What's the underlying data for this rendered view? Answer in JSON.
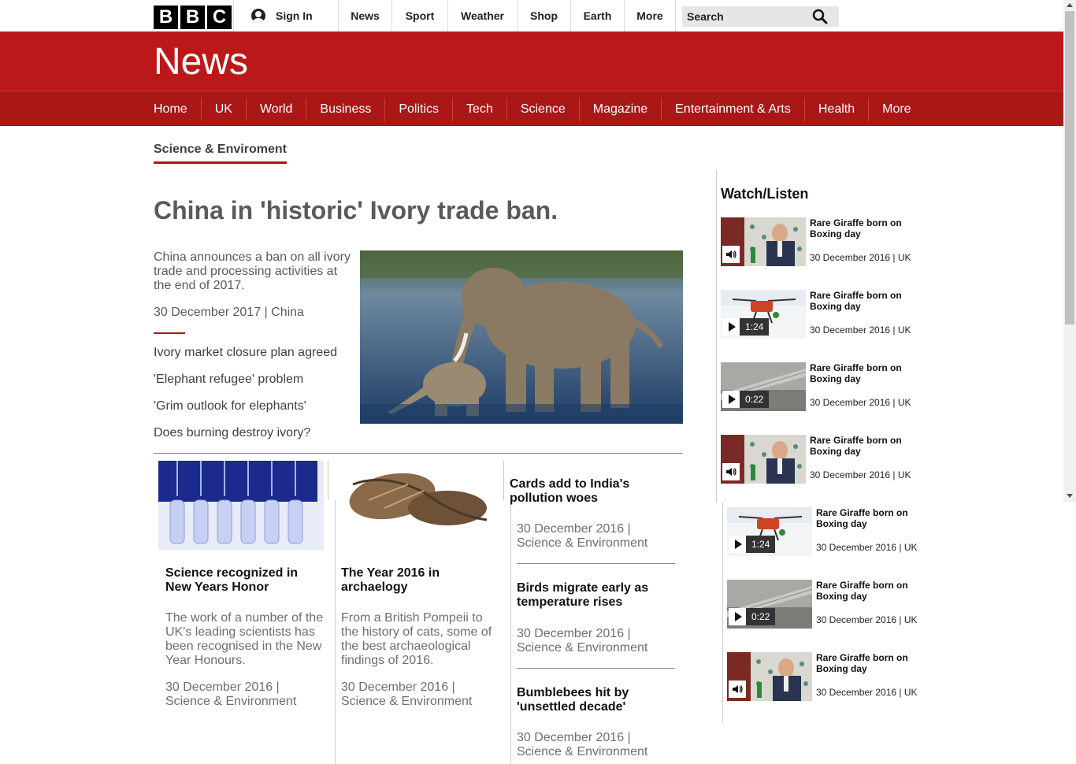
{
  "topbar": {
    "logo_letters": [
      "B",
      "B",
      "C"
    ],
    "signin_label": "Sign In",
    "nav": [
      "News",
      "Sport",
      "Weather",
      "Shop",
      "Earth",
      "More"
    ],
    "search_placeholder": "Search"
  },
  "news": {
    "title": "News",
    "subnav": [
      "Home",
      "UK",
      "World",
      "Business",
      "Politics",
      "Tech",
      "Science",
      "Magazine",
      "Entertainment & Arts",
      "Health",
      "More"
    ]
  },
  "section": {
    "label": "Science & Enviroment"
  },
  "lead": {
    "headline": "China in 'historic' Ivory trade ban.",
    "summary": "China announces a ban on all ivory trade and processing activities at the end of 2017.",
    "date": "30 December 2017 | China",
    "related": [
      "Ivory market closure plan agreed",
      "'Elephant refugee' problem",
      "'Grim outlook for elephants'",
      "Does burning destroy ivory?"
    ]
  },
  "cards": [
    {
      "title": "Science recognized in New Years Honor",
      "summary": "The work of a number of the UK's leading scientists has been recognised in the New Year Honours.",
      "date": "30 December 2016 | Science & Environment"
    },
    {
      "title": "The Year 2016 in archaelogy",
      "summary": "From a British Pompeii to the history of cats, some of the best archaeological findings of 2016.",
      "date": "30 December 2016 | Science & Environment"
    }
  ],
  "list_stories": [
    {
      "title": "Cards add to India's pollution woes",
      "date": "30 December 2016 | Science & Environment"
    },
    {
      "title": "Birds migrate early as temperature rises",
      "date": "30 December 2016 | Science & Environment"
    },
    {
      "title": "Bumblebees hit by 'unsettled decade'",
      "date": "30 December 2016 | Science & Environment"
    }
  ],
  "watch_listen": {
    "title": "Watch/Listen",
    "items": [
      {
        "title": "Rare Giraffe born on Boxing day",
        "date": "30 December 2016 | UK",
        "type": "audio",
        "thumb": "interview"
      },
      {
        "title": "Rare Giraffe born on Boxing day",
        "date": "30 December 2016 | UK",
        "type": "video",
        "duration": "1:24",
        "thumb": "drone"
      },
      {
        "title": "Rare Giraffe born on Boxing day",
        "date": "30 December 2016 | UK",
        "type": "video",
        "duration": "0:22",
        "thumb": "wing"
      },
      {
        "title": "Rare Giraffe born on Boxing day",
        "date": "30 December 2016 | UK",
        "type": "audio",
        "thumb": "interview"
      },
      {
        "title": "Rare Giraffe born on Boxing day",
        "date": "30 December 2016 | UK",
        "type": "video",
        "duration": "1:24",
        "thumb": "drone"
      },
      {
        "title": "Rare Giraffe born on Boxing day",
        "date": "30 December 2016 | UK",
        "type": "video",
        "duration": "0:22",
        "thumb": "wing"
      },
      {
        "title": "Rare Giraffe born on Boxing day",
        "date": "30 December 2016 | UK",
        "type": "audio",
        "thumb": "interview"
      }
    ]
  },
  "colors": {
    "brand_red": "#bb1919",
    "subnav_red": "#a91717"
  }
}
